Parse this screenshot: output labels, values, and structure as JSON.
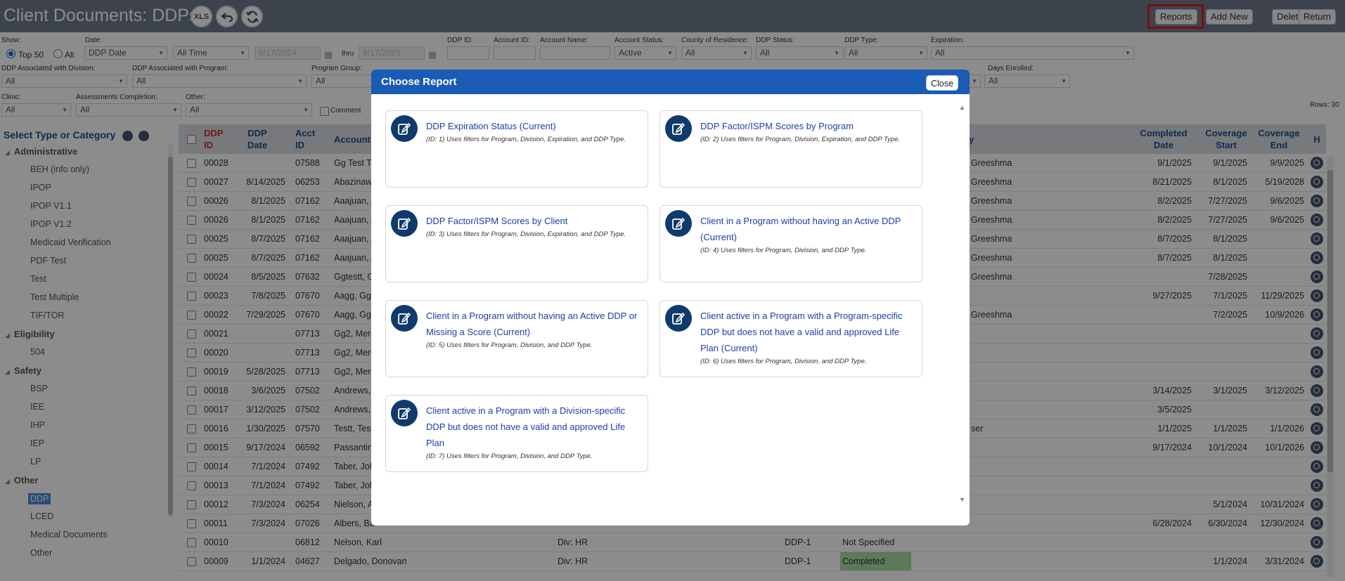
{
  "header": {
    "title": "Client Documents: DDPs",
    "xls_label": "XLS",
    "buttons": {
      "reports": "Reports",
      "add_new": "Add New",
      "delete": "Delete",
      "return": "Return"
    }
  },
  "filters": {
    "show_label": "Show:",
    "top50_label": "Top 50",
    "all_label": "All",
    "date_label": "Date:",
    "date_type": "DDP Date",
    "date_range": "All Time",
    "date_from": "9/17/2024",
    "thru_label": "thru",
    "date_to": "9/17/2025",
    "ddp_id_label": "DDP ID:",
    "account_id_label": "Account ID:",
    "account_name_label": "Account Name:",
    "account_status_label": "Account Status:",
    "account_status_value": "Active",
    "county_label": "County of Residence:",
    "county_value": "All",
    "ddp_status_label": "DDP Status:",
    "ddp_status_value": "All",
    "ddp_type_label": "DDP Type:",
    "ddp_type_value": "All",
    "expiration_label": "Expiration:",
    "expiration_value": "All",
    "division_label": "DDP Associated with Division:",
    "division_value": "All",
    "program_label": "DDP Associated with Program:",
    "program_value": "All",
    "program_group_label": "Program Group:",
    "program_group_value": "All",
    "days_enrolled_label": "Days Enrolled:",
    "days_enrolled_value": "All",
    "clinic_label": "Clinic:",
    "clinic_value": "All",
    "assess_label": "Assessments Completion:",
    "assess_value": "All",
    "other_label": "Other:",
    "other_value": "All",
    "comment_label": "Comment",
    "rows_label": "Rows: 30"
  },
  "left_panel": {
    "heading": "Select Type or Category",
    "categories": [
      {
        "name": "Administrative",
        "items": [
          "BEH (info only)",
          "IPOP",
          "IPOP V1.1",
          "IPOP V1.2",
          "Medicaid Verification",
          "PDF Test",
          "Test",
          "Test Multiple",
          "TIF/TOR"
        ]
      },
      {
        "name": "Eligibility",
        "items": [
          "504"
        ]
      },
      {
        "name": "Safety",
        "items": [
          "BSP",
          "IEE",
          "IHP",
          "IEP",
          "LP"
        ]
      },
      {
        "name": "Other",
        "items": [
          "DDP",
          "LCED",
          "Medical Documents",
          "Other"
        ]
      }
    ],
    "selected": "DDP"
  },
  "grid": {
    "headers": {
      "ddp_id": "DDP ID",
      "ddp_date": "DDP Date",
      "acct_id": "Acct ID",
      "account": "Account",
      "y": "y",
      "completed_date": "Completed Date",
      "coverage_start": "Coverage Start",
      "coverage_end": "Coverage End",
      "h": "H"
    },
    "rows": [
      {
        "id": "00028",
        "date": "",
        "acct": "07588",
        "account": "Gg Test Tr",
        "prog": "",
        "type": "",
        "status": "",
        "by": "Greeshma",
        "completed": "9/1/2025",
        "start": "9/1/2025",
        "end": "9/9/2025"
      },
      {
        "id": "00027",
        "date": "8/14/2025",
        "acct": "06253",
        "account": "Abazinaw,",
        "prog": "",
        "type": "",
        "status": "",
        "by": "Greeshma",
        "completed": "8/21/2025",
        "start": "8/1/2025",
        "end": "5/19/2028"
      },
      {
        "id": "00026",
        "date": "8/1/2025",
        "acct": "07162",
        "account": "Aaajuan, A",
        "prog": "",
        "type": "",
        "status": "",
        "by": "Greeshma",
        "completed": "8/2/2025",
        "start": "7/27/2025",
        "end": "9/6/2025"
      },
      {
        "id": "00026",
        "date": "8/1/2025",
        "acct": "07162",
        "account": "Aaajuan, A",
        "prog": "",
        "type": "",
        "status": "",
        "by": "Greeshma",
        "completed": "8/2/2025",
        "start": "7/27/2025",
        "end": "9/6/2025"
      },
      {
        "id": "00025",
        "date": "8/7/2025",
        "acct": "07162",
        "account": "Aaajuan, A",
        "prog": "",
        "type": "",
        "status": "",
        "by": "Greeshma",
        "completed": "8/7/2025",
        "start": "8/1/2025",
        "end": ""
      },
      {
        "id": "00025",
        "date": "8/7/2025",
        "acct": "07162",
        "account": "Aaajuan, A",
        "prog": "",
        "type": "",
        "status": "",
        "by": "Greeshma",
        "completed": "8/7/2025",
        "start": "8/1/2025",
        "end": ""
      },
      {
        "id": "00024",
        "date": "8/5/2025",
        "acct": "07632",
        "account": "Ggtestt, G",
        "prog": "",
        "type": "",
        "status": "",
        "by": "Greeshma",
        "completed": "",
        "start": "7/28/2025",
        "end": ""
      },
      {
        "id": "00023",
        "date": "7/8/2025",
        "acct": "07670",
        "account": "Aagg, Gg",
        "prog": "",
        "type": "",
        "status": "",
        "by": "",
        "completed": "9/27/2025",
        "start": "7/1/2025",
        "end": "11/29/2025"
      },
      {
        "id": "00022",
        "date": "7/29/2025",
        "acct": "07670",
        "account": "Aagg, Gg",
        "prog": "",
        "type": "",
        "status": "",
        "by": "Greeshma",
        "completed": "",
        "start": "7/2/2025",
        "end": "10/9/2026"
      },
      {
        "id": "00021",
        "date": "",
        "acct": "07713",
        "account": "Gg2, Merg",
        "prog": "",
        "type": "",
        "status": "",
        "by": "",
        "completed": "",
        "start": "",
        "end": ""
      },
      {
        "id": "00020",
        "date": "",
        "acct": "07713",
        "account": "Gg2, Merg",
        "prog": "",
        "type": "",
        "status": "",
        "by": "",
        "completed": "",
        "start": "",
        "end": ""
      },
      {
        "id": "00019",
        "date": "5/28/2025",
        "acct": "07713",
        "account": "Gg2, Merg",
        "prog": "",
        "type": "",
        "status": "",
        "by": "",
        "completed": "",
        "start": "",
        "end": ""
      },
      {
        "id": "00018",
        "date": "3/6/2025",
        "acct": "07502",
        "account": "Andrews,",
        "prog": "",
        "type": "",
        "status": "",
        "by": "",
        "completed": "3/14/2025",
        "start": "3/1/2025",
        "end": "3/12/2025"
      },
      {
        "id": "00017",
        "date": "3/12/2025",
        "acct": "07502",
        "account": "Andrews,",
        "prog": "",
        "type": "",
        "status": "",
        "by": "",
        "completed": "3/5/2025",
        "start": "",
        "end": ""
      },
      {
        "id": "00016",
        "date": "1/30/2025",
        "acct": "07570",
        "account": "Testt, Test",
        "prog": "",
        "type": "",
        "status": "",
        "by": "ser",
        "completed": "1/1/2025",
        "start": "1/1/2025",
        "end": "1/1/2026"
      },
      {
        "id": "00015",
        "date": "9/17/2024",
        "acct": "06592",
        "account": "Passantino",
        "prog": "",
        "type": "",
        "status": "",
        "by": "",
        "completed": "9/17/2024",
        "start": "10/1/2024",
        "end": "10/1/2026"
      },
      {
        "id": "00014",
        "date": "7/1/2024",
        "acct": "07492",
        "account": "Taber, Joh",
        "prog": "",
        "type": "",
        "status": "",
        "by": "",
        "completed": "",
        "start": "",
        "end": ""
      },
      {
        "id": "00013",
        "date": "7/1/2024",
        "acct": "07492",
        "account": "Taber, Joh",
        "prog": "",
        "type": "",
        "status": "",
        "by": "",
        "completed": "",
        "start": "",
        "end": ""
      },
      {
        "id": "00012",
        "date": "7/3/2024",
        "acct": "06254",
        "account": "Nielson, A",
        "prog": "",
        "type": "",
        "status": "",
        "by": "",
        "completed": "",
        "start": "5/1/2024",
        "end": "10/31/2024"
      },
      {
        "id": "00011",
        "date": "7/3/2024",
        "acct": "07026",
        "account": "Albers, Ba",
        "prog": "",
        "type": "",
        "status": "",
        "by": "",
        "completed": "6/28/2024",
        "start": "6/30/2024",
        "end": "12/30/2024"
      },
      {
        "id": "00010",
        "date": "",
        "acct": "06812",
        "account": "Nelson, Karl",
        "prog": "Div: HR",
        "type": "DDP-1",
        "status": "Not Specified",
        "by": "",
        "completed": "",
        "start": "",
        "end": ""
      },
      {
        "id": "00009",
        "date": "1/1/2024",
        "acct": "04627",
        "account": "Delgado, Donovan",
        "prog": "Div: HR",
        "type": "DDP-1",
        "status": "Completed",
        "by": "",
        "completed": "",
        "start": "1/1/2024",
        "end": "3/31/2024"
      }
    ]
  },
  "modal": {
    "title": "Choose Report",
    "close_label": "Close",
    "reports": [
      {
        "title": "DDP Expiration Status (Current)",
        "desc": "(ID: 1) Uses filters for Program, Division, Expiration, and DDP Type."
      },
      {
        "title": "DDP Factor/ISPM Scores by Program",
        "desc": "(ID: 2) Uses filters for Program, Division, Expiration, and DDP Type."
      },
      {
        "title": "DDP Factor/ISPM Scores by Client",
        "desc": "(ID: 3) Uses filters for Program, Division, Expiration, and DDP Type."
      },
      {
        "title": "Client in a Program without having an Active DDP (Current)",
        "desc": "(ID: 4) Uses filters for Program, Division, and DDP Type."
      },
      {
        "title": "Client in a Program without having an Active DDP or Missing a Score (Current)",
        "desc": "(ID: 5) Uses filters for Program, Division, and DDP Type."
      },
      {
        "title": "Client active in a Program with a Program-specific DDP but does not have a valid and approved Life Plan (Current)",
        "desc": "(ID: 6) Uses filters for Program, Division, and DDP Type."
      },
      {
        "title": "Client active in a Program with a Division-specific DDP but does not have a valid and approved Life Plan",
        "desc": "(ID: 7) Uses filters for Program, Division, and DDP Type."
      }
    ]
  },
  "colors": {
    "header_bg": "#6d7a8c",
    "modal_header": "#1a5bb5",
    "link": "#1a3fa8",
    "highlight": "#e0191c",
    "status_green": "#a8dca3"
  }
}
